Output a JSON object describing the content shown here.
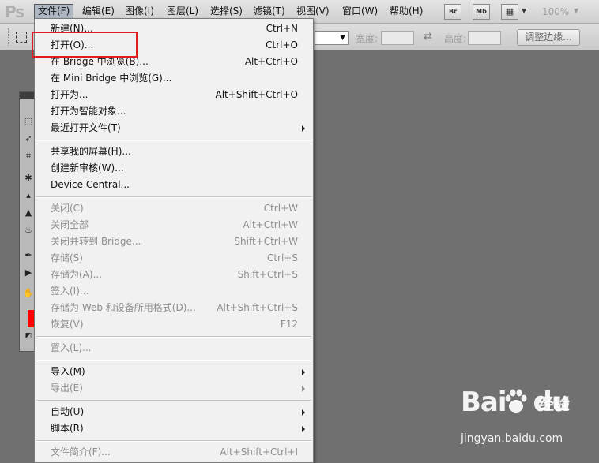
{
  "app": {
    "logo": "Ps"
  },
  "menubar": {
    "items": [
      "文件(F)",
      "编辑(E)",
      "图像(I)",
      "图层(L)",
      "选择(S)",
      "滤镜(T)",
      "视图(V)",
      "窗口(W)",
      "帮助(H)"
    ],
    "active_index": 0,
    "bridge_button": "Br",
    "minibridge_button": "Mb",
    "zoom": "100%"
  },
  "options": {
    "width_label": "宽度:",
    "height_label": "高度:",
    "refine_edge": "调整边缘..."
  },
  "file_menu": {
    "groups": [
      [
        {
          "label": "新建(N)...",
          "shortcut": "Ctrl+N",
          "enabled": true
        },
        {
          "label": "打开(O)...",
          "shortcut": "Ctrl+O",
          "enabled": true
        },
        {
          "label": "在 Bridge 中浏览(B)...",
          "shortcut": "Alt+Ctrl+O",
          "enabled": true
        },
        {
          "label": "在 Mini Bridge 中浏览(G)...",
          "shortcut": "",
          "enabled": true
        },
        {
          "label": "打开为...",
          "shortcut": "Alt+Shift+Ctrl+O",
          "enabled": true
        },
        {
          "label": "打开为智能对象...",
          "shortcut": "",
          "enabled": true
        },
        {
          "label": "最近打开文件(T)",
          "shortcut": "",
          "enabled": true,
          "submenu": true
        }
      ],
      [
        {
          "label": "共享我的屏幕(H)...",
          "shortcut": "",
          "enabled": true
        },
        {
          "label": "创建新审核(W)...",
          "shortcut": "",
          "enabled": true
        },
        {
          "label": "Device Central...",
          "shortcut": "",
          "enabled": true
        }
      ],
      [
        {
          "label": "关闭(C)",
          "shortcut": "Ctrl+W",
          "enabled": false
        },
        {
          "label": "关闭全部",
          "shortcut": "Alt+Ctrl+W",
          "enabled": false
        },
        {
          "label": "关闭并转到 Bridge...",
          "shortcut": "Shift+Ctrl+W",
          "enabled": false
        },
        {
          "label": "存储(S)",
          "shortcut": "Ctrl+S",
          "enabled": false
        },
        {
          "label": "存储为(A)...",
          "shortcut": "Shift+Ctrl+S",
          "enabled": false
        },
        {
          "label": "签入(I)...",
          "shortcut": "",
          "enabled": false
        },
        {
          "label": "存储为 Web 和设备所用格式(D)...",
          "shortcut": "Alt+Shift+Ctrl+S",
          "enabled": false
        },
        {
          "label": "恢复(V)",
          "shortcut": "F12",
          "enabled": false
        }
      ],
      [
        {
          "label": "置入(L)...",
          "shortcut": "",
          "enabled": false
        }
      ],
      [
        {
          "label": "导入(M)",
          "shortcut": "",
          "enabled": true,
          "submenu": true
        },
        {
          "label": "导出(E)",
          "shortcut": "",
          "enabled": false,
          "submenu": true
        }
      ],
      [
        {
          "label": "自动(U)",
          "shortcut": "",
          "enabled": true,
          "submenu": true
        },
        {
          "label": "脚本(R)",
          "shortcut": "",
          "enabled": true,
          "submenu": true
        }
      ],
      [
        {
          "label": "文件简介(F)...",
          "shortcut": "Alt+Shift+Ctrl+I",
          "enabled": false
        }
      ]
    ]
  },
  "annotation": {
    "highlight_color": "#e21b1b"
  },
  "watermark": {
    "logo": "Bai",
    "logo2": "du",
    "text": "经验",
    "url": "jingyan.baidu.com"
  }
}
